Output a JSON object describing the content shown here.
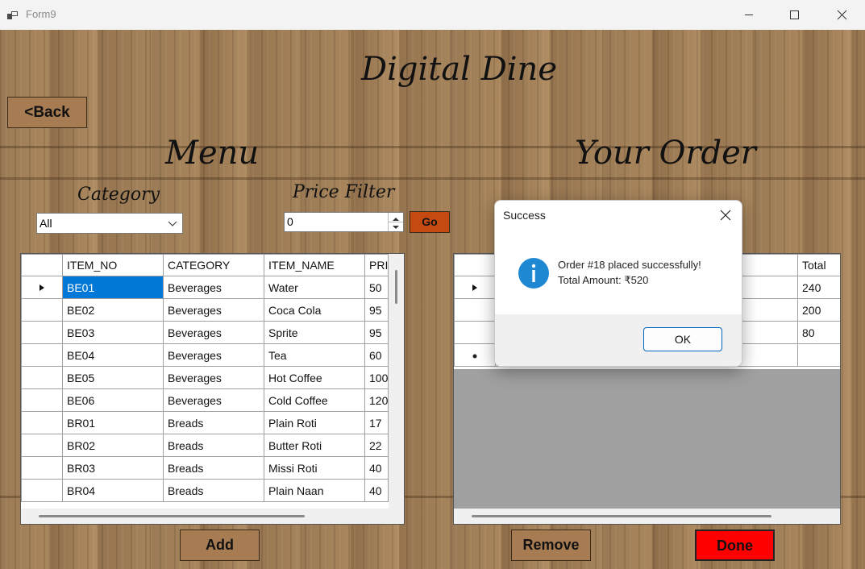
{
  "window": {
    "title": "Form9"
  },
  "header": {
    "app_title": "Digital Dine",
    "back_label": "<Back",
    "menu_heading": "Menu",
    "order_heading": "Your Order"
  },
  "filters": {
    "category_label": "Category",
    "category_value": "All",
    "price_label": "Price Filter",
    "price_value": "0",
    "go_label": "Go"
  },
  "menu_grid": {
    "columns": [
      "ITEM_NO",
      "CATEGORY",
      "ITEM_NAME",
      "PRI"
    ],
    "rows": [
      [
        "BE01",
        "Beverages",
        "Water",
        "50"
      ],
      [
        "BE02",
        "Beverages",
        "Coca Cola",
        "95"
      ],
      [
        "BE03",
        "Beverages",
        "Sprite",
        "95"
      ],
      [
        "BE04",
        "Beverages",
        "Tea",
        "60"
      ],
      [
        "BE05",
        "Beverages",
        "Hot Coffee",
        "100"
      ],
      [
        "BE06",
        "Beverages",
        "Cold Coffee",
        "120"
      ],
      [
        "BR01",
        "Breads",
        "Plain Roti",
        "17"
      ],
      [
        "BR02",
        "Breads",
        "Butter Roti",
        "22"
      ],
      [
        "BR03",
        "Breads",
        "Missi Roti",
        "40"
      ],
      [
        "BR04",
        "Breads",
        "Plain Naan",
        "40"
      ]
    ]
  },
  "order_grid": {
    "columns": [
      "",
      "",
      "",
      "Total"
    ],
    "rows": [
      [
        "",
        "",
        "",
        "240"
      ],
      [
        "",
        "",
        "",
        "200"
      ],
      [
        "",
        "",
        "",
        "80"
      ]
    ]
  },
  "actions": {
    "add_label": "Add",
    "remove_label": "Remove",
    "done_label": "Done"
  },
  "dialog": {
    "title": "Success",
    "line1": "Order #18 placed successfully!",
    "line2": "Total Amount: ₹520",
    "ok_label": "OK",
    "icon": "info-icon"
  },
  "colors": {
    "back_button": "#a87c52",
    "go_button": "#c44a12",
    "done_button": "#ff0000",
    "selection": "#0078d7",
    "info_icon": "#1e88d2"
  }
}
